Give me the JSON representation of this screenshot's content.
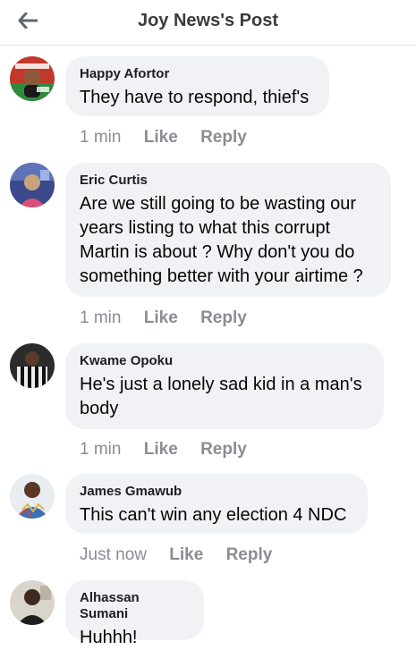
{
  "header": {
    "title": "Joy News's Post"
  },
  "comments": [
    {
      "author": "Happy Afortor",
      "text": "They have to respond, thief's",
      "time": "1 min",
      "like": "Like",
      "reply": "Reply"
    },
    {
      "author": "Eric Curtis",
      "text": "Are we still going to be wasting our years listing to what this corrupt Martin is about ? Why don't you do something better with your airtime ?",
      "time": "1 min",
      "like": "Like",
      "reply": "Reply"
    },
    {
      "author": "Kwame Opoku",
      "text": "He's just a lonely sad kid in a man's body",
      "time": "1 min",
      "like": "Like",
      "reply": "Reply"
    },
    {
      "author": "James Gmawub",
      "text": "This can't win any election 4 NDC",
      "time": "Just now",
      "like": "Like",
      "reply": "Reply"
    },
    {
      "author": "Alhassan Sumani",
      "text": "Huhhh!",
      "time": "",
      "like": "",
      "reply": ""
    }
  ]
}
